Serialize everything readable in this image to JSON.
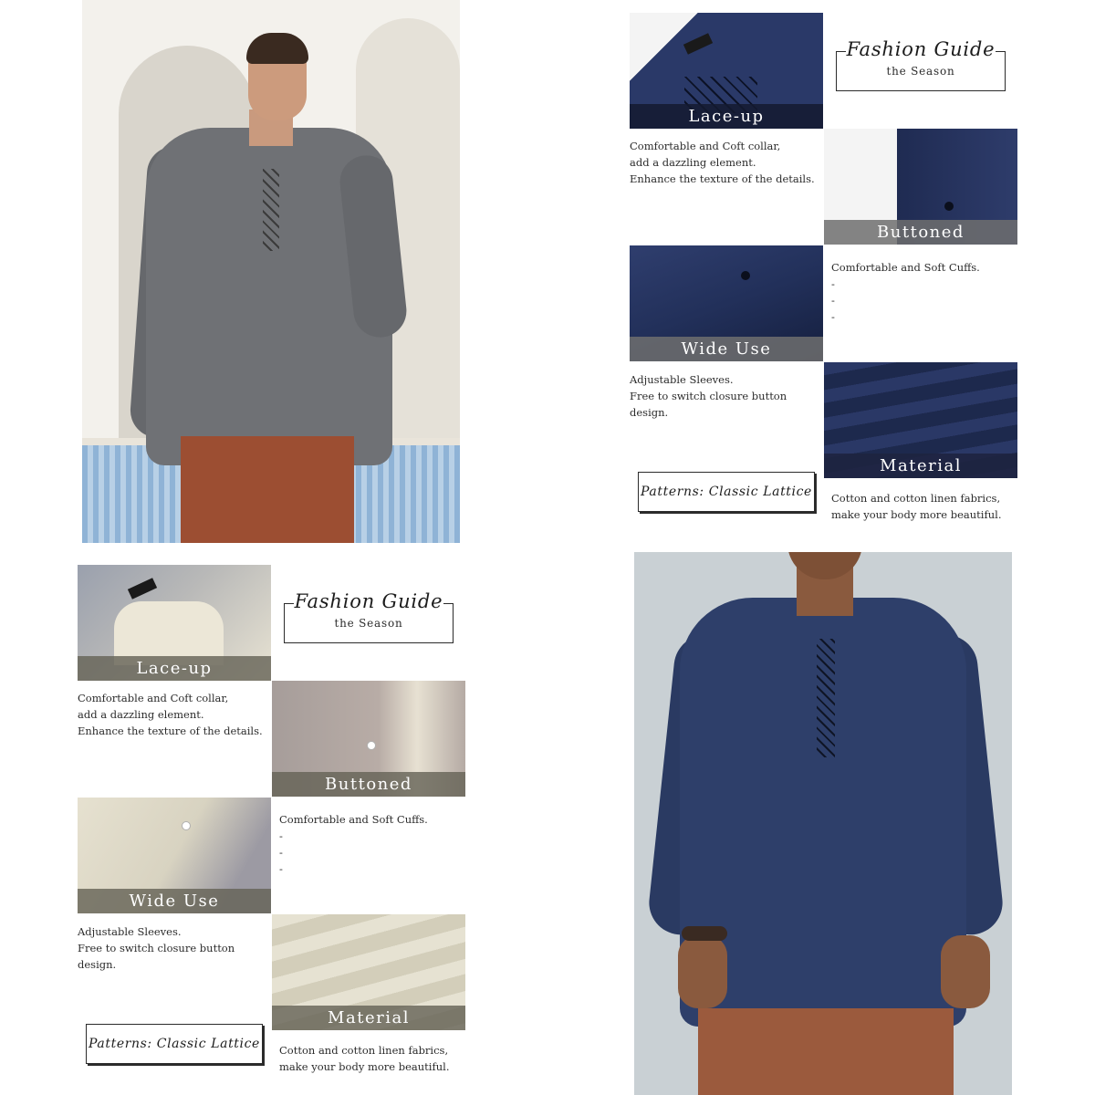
{
  "panels": [
    {
      "theme": "navy",
      "guide": {
        "title": "Fashion Guide",
        "subtitle": "the Season"
      },
      "tiles": [
        {
          "label": "Lace-up",
          "desc": [
            "Comfortable and Coft collar,",
            "add a dazzling element.",
            "Enhance the texture of the details."
          ]
        },
        {
          "label": "Buttoned",
          "desc": [
            "Comfortable and Soft Cuffs.",
            "-",
            "-",
            "-"
          ]
        },
        {
          "label": "Wide Use",
          "desc": [
            "Adjustable Sleeves.",
            "Free to switch closure button",
            "design."
          ]
        },
        {
          "label": "Material",
          "desc": [
            "Cotton and cotton linen fabrics,",
            "make your body more beautiful."
          ]
        }
      ],
      "patterns": "Patterns: Classic Lattice"
    },
    {
      "theme": "cream",
      "guide": {
        "title": "Fashion Guide",
        "subtitle": "the Season"
      },
      "tiles": [
        {
          "label": "Lace-up",
          "desc": [
            "Comfortable and Coft collar,",
            "add a dazzling element.",
            "Enhance the texture of the details."
          ]
        },
        {
          "label": "Buttoned",
          "desc": [
            "Comfortable and Soft Cuffs.",
            "-",
            "-",
            "-"
          ]
        },
        {
          "label": "Wide Use",
          "desc": [
            "Adjustable Sleeves.",
            "Free to switch closure button",
            "design."
          ]
        },
        {
          "label": "Material",
          "desc": [
            "Cotton and cotton linen fabrics,",
            "make your body more beautiful."
          ]
        }
      ],
      "patterns": "Patterns: Classic Lattice"
    }
  ],
  "photos": {
    "top_left": "grey lace-up shirt model",
    "bottom_right": "navy lace-up shirt model"
  },
  "colors": {
    "navy_shirt": "#2e3f6a",
    "grey_shirt": "#6f7175",
    "cream_shirt": "#e6e1d0",
    "pants": "#9c4e32"
  }
}
